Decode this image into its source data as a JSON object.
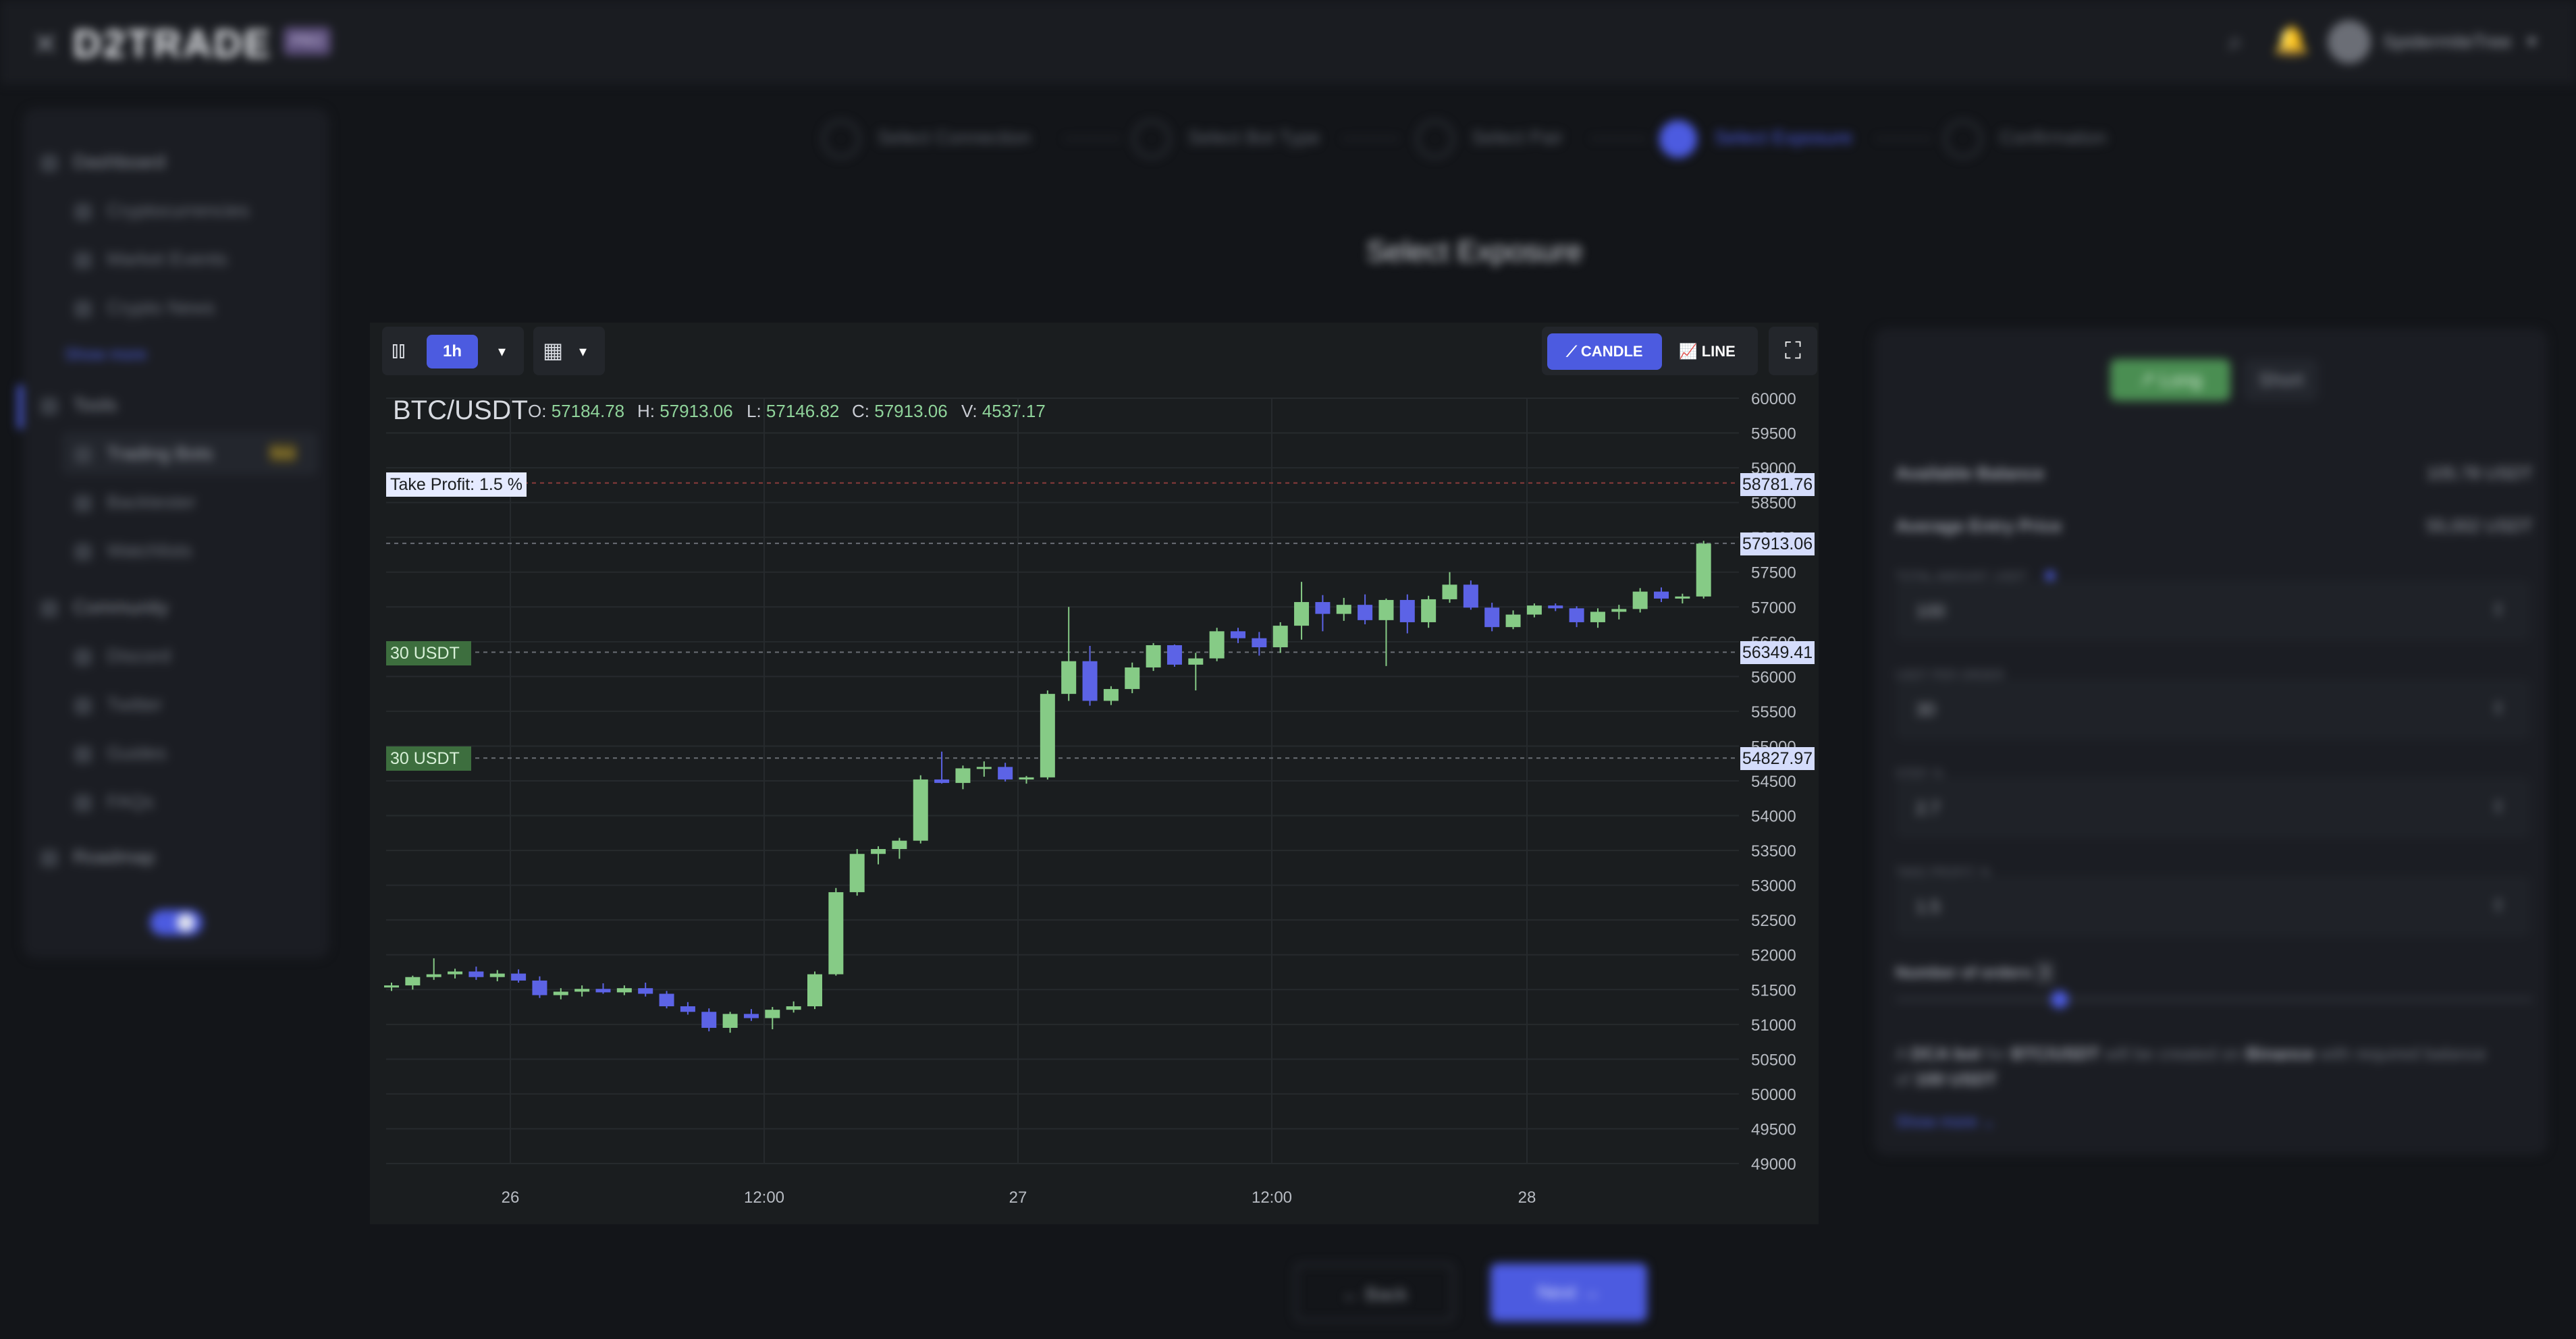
{
  "app": {
    "logo_text": "D2TRADE",
    "logo_badge": "PRO",
    "close_icon": "close-icon",
    "username": "SpidermiteTree"
  },
  "sidebar": {
    "items": [
      {
        "label": "Dashboard",
        "icon": "home-icon",
        "head": true
      },
      {
        "label": "Cryptocurrencies",
        "icon": "coins-icon"
      },
      {
        "label": "Market Events",
        "icon": "events-icon"
      },
      {
        "label": "Crypto News",
        "icon": "news-icon"
      },
      {
        "label": "Tools",
        "icon": "tools-icon",
        "head": true
      },
      {
        "label": "Trading Bots",
        "icon": "bot-icon"
      },
      {
        "label": "Backtester",
        "icon": "backtest-icon"
      },
      {
        "label": "Watchlists",
        "icon": "watchlist-icon"
      },
      {
        "label": "Community",
        "icon": "community-icon",
        "head": true
      },
      {
        "label": "Discord",
        "icon": "discord-icon"
      },
      {
        "label": "Twitter",
        "icon": "twitter-icon"
      },
      {
        "label": "Guides",
        "icon": "guides-icon"
      },
      {
        "label": "FAQs",
        "icon": "faq-icon"
      },
      {
        "label": "Roadmap",
        "icon": "roadmap-icon",
        "head": true
      }
    ],
    "show_more": "Show more",
    "new_badge": "New"
  },
  "stepper": {
    "steps": [
      {
        "num": "1",
        "label": "Select Connection"
      },
      {
        "num": "2",
        "label": "Select Bot Type"
      },
      {
        "num": "3",
        "label": "Select Pair"
      },
      {
        "num": "4",
        "label": "Select Exposure"
      },
      {
        "num": "5",
        "label": "Confirmation"
      }
    ],
    "active": 4
  },
  "page_title": "Select Exposure",
  "chart_toolbar": {
    "timeframe": "1h",
    "candle_label": "CANDLE",
    "line_label": "LINE"
  },
  "chart_header": {
    "pair": "BTC/USDT",
    "open_label": "O:",
    "open": "57184.78",
    "high_label": "H:",
    "high": "57913.06",
    "low_label": "L:",
    "low": "57146.82",
    "close_label": "C:",
    "close": "57913.06",
    "volume_label": "V:",
    "volume": "4537.17"
  },
  "chart_levels": {
    "take_profit_label": "Take Profit: 1.5 %",
    "take_profit_price": "58781.76",
    "last_price": "57913.06",
    "order1_label": "30 USDT",
    "order1_price": "56349.41",
    "order2_label": "30 USDT",
    "order2_price": "54827.97"
  },
  "chart_data": {
    "type": "candlestick",
    "pair": "BTC/USDT",
    "up_color": "#86cb86",
    "down_color": "#5c63e6",
    "ylim": [
      49000,
      60000
    ],
    "y_ticks": [
      49000,
      49500,
      50000,
      50500,
      51000,
      51500,
      52000,
      52500,
      53000,
      53500,
      54000,
      54500,
      55000,
      55500,
      56000,
      56500,
      57000,
      57500,
      58000,
      58500,
      59000,
      59500,
      60000
    ],
    "x_tick_labels": [
      "26",
      "12:00",
      "27",
      "12:00",
      "28"
    ],
    "candles": [
      [
        51530,
        51600,
        51480,
        51560
      ],
      [
        51560,
        51700,
        51500,
        51680
      ],
      [
        51680,
        51950,
        51640,
        51720
      ],
      [
        51720,
        51800,
        51660,
        51760
      ],
      [
        51760,
        51830,
        51640,
        51680
      ],
      [
        51680,
        51780,
        51620,
        51730
      ],
      [
        51730,
        51790,
        51600,
        51630
      ],
      [
        51630,
        51690,
        51380,
        51420
      ],
      [
        51420,
        51520,
        51360,
        51470
      ],
      [
        51470,
        51560,
        51400,
        51510
      ],
      [
        51510,
        51590,
        51440,
        51460
      ],
      [
        51460,
        51560,
        51420,
        51520
      ],
      [
        51520,
        51600,
        51400,
        51440
      ],
      [
        51440,
        51480,
        51230,
        51260
      ],
      [
        51260,
        51320,
        51140,
        51180
      ],
      [
        51180,
        51230,
        50900,
        50950
      ],
      [
        50950,
        51180,
        50880,
        51150
      ],
      [
        51150,
        51220,
        51050,
        51090
      ],
      [
        51090,
        51250,
        50930,
        51210
      ],
      [
        51210,
        51330,
        51170,
        51260
      ],
      [
        51260,
        51760,
        51220,
        51720
      ],
      [
        51720,
        52960,
        51700,
        52900
      ],
      [
        52900,
        53520,
        52850,
        53450
      ],
      [
        53450,
        53560,
        53300,
        53520
      ],
      [
        53520,
        53680,
        53380,
        53640
      ],
      [
        53640,
        54580,
        53600,
        54520
      ],
      [
        54520,
        54920,
        54460,
        54470
      ],
      [
        54470,
        54720,
        54380,
        54680
      ],
      [
        54680,
        54780,
        54560,
        54700
      ],
      [
        54700,
        54760,
        54490,
        54520
      ],
      [
        54520,
        54570,
        54460,
        54550
      ],
      [
        54550,
        55800,
        54520,
        55750
      ],
      [
        55750,
        57000,
        55650,
        56220
      ],
      [
        56220,
        56440,
        55580,
        55650
      ],
      [
        55650,
        55860,
        55590,
        55820
      ],
      [
        55820,
        56200,
        55760,
        56130
      ],
      [
        56130,
        56480,
        56080,
        56450
      ],
      [
        56450,
        56460,
        56140,
        56170
      ],
      [
        56170,
        56340,
        55800,
        56260
      ],
      [
        56260,
        56700,
        56220,
        56650
      ],
      [
        56650,
        56700,
        56480,
        56550
      ],
      [
        56550,
        56640,
        56300,
        56420
      ],
      [
        56420,
        56780,
        56340,
        56730
      ],
      [
        56730,
        57360,
        56530,
        57070
      ],
      [
        57070,
        57170,
        56650,
        56900
      ],
      [
        56900,
        57130,
        56800,
        57030
      ],
      [
        57030,
        57180,
        56750,
        56810
      ],
      [
        56810,
        57120,
        56150,
        57100
      ],
      [
        57100,
        57180,
        56620,
        56780
      ],
      [
        56780,
        57160,
        56700,
        57110
      ],
      [
        57110,
        57500,
        57060,
        57320
      ],
      [
        57320,
        57380,
        56960,
        56990
      ],
      [
        56990,
        57060,
        56650,
        56710
      ],
      [
        56710,
        56950,
        56680,
        56890
      ],
      [
        56890,
        57050,
        56850,
        57020
      ],
      [
        57020,
        57050,
        56940,
        56980
      ],
      [
        56980,
        57010,
        56710,
        56780
      ],
      [
        56780,
        56980,
        56700,
        56930
      ],
      [
        56930,
        57030,
        56820,
        56970
      ],
      [
        56970,
        57270,
        56920,
        57220
      ],
      [
        57220,
        57280,
        57070,
        57120
      ],
      [
        57120,
        57190,
        57050,
        57150
      ],
      [
        57150,
        57950,
        57120,
        57910
      ]
    ]
  },
  "right_panel": {
    "long_label": "Long",
    "short_label": "Short",
    "available_balance_label": "Available Balance",
    "available_balance": "105.78 USDT",
    "avg_entry_label": "Average Entry Price",
    "avg_entry": "55,002 USDT",
    "fields": [
      {
        "caption": "TOTAL AMOUNT, USDT",
        "value": "100"
      },
      {
        "caption": "USDT PER ORDER",
        "value": "30"
      },
      {
        "caption": "STEP, %",
        "value": "2.7"
      },
      {
        "caption": "TAKE PROFIT, %",
        "value": "1.5"
      }
    ],
    "orders_label": "Number of orders",
    "orders_value": "3",
    "summary_prefix": "A",
    "summary_bot": "DCA bot",
    "summary_for": "for",
    "summary_pair": "BTC/USDT",
    "summary_created": "will be created on",
    "summary_exchange": "Binance",
    "summary_with": "with required balance of",
    "summary_amount": "100 USDT",
    "show_more": "Show more"
  },
  "footer": {
    "back_label": "Back",
    "next_label": "Next"
  }
}
